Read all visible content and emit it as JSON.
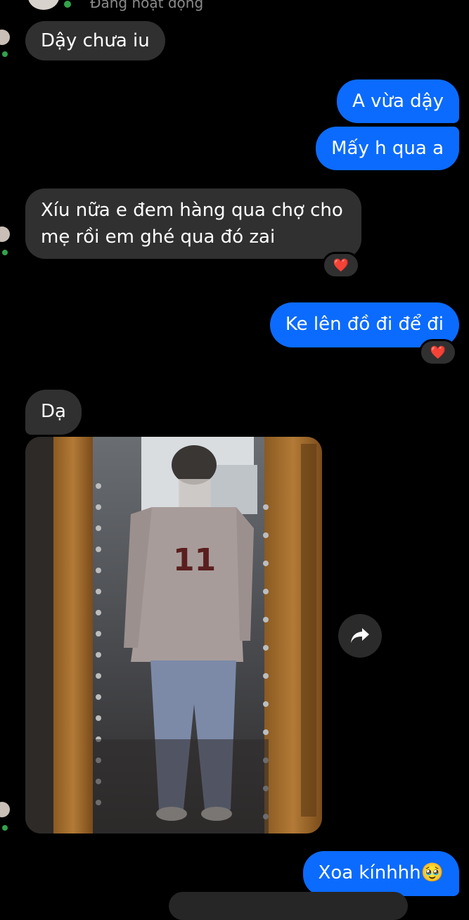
{
  "header": {
    "status": "Đang hoạt động"
  },
  "messages": {
    "m1": "Dậy chưa iu",
    "m2": "A vừa dậy",
    "m3": "Mấy h qua a",
    "m4_line1": "Xíu nữa e đem hàng qua chợ cho",
    "m4_line2": "mẹ rồi em ghé qua đó zai",
    "m5": "Ke lên đồ đi để đi",
    "m6": "Dạ",
    "m7": "Xoa kínhhh🥹"
  },
  "reactions": {
    "r1": "❤️",
    "r2": "❤️"
  },
  "colors": {
    "outgoing": "#0b6bff",
    "incoming": "#303030",
    "online": "#31a24c"
  },
  "icons": {
    "share": "share-arrow-icon",
    "heart": "heart-icon"
  }
}
